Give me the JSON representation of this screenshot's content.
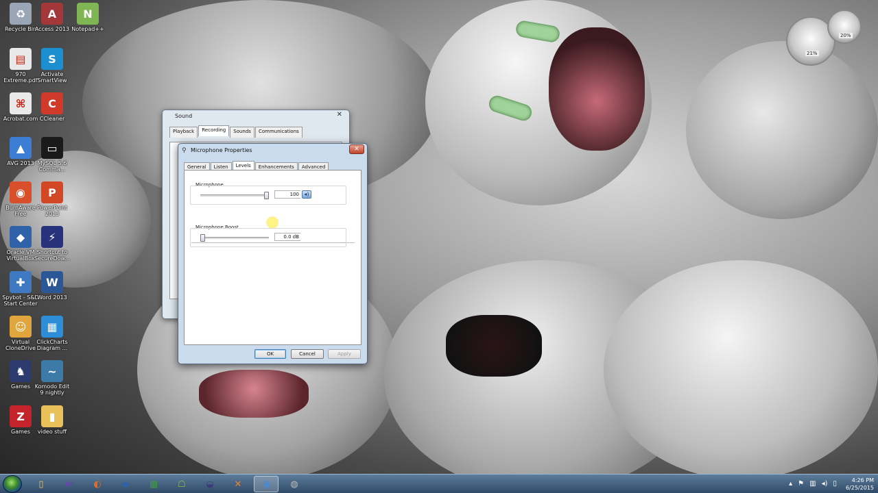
{
  "desktop": {
    "icons": [
      {
        "label": "Recycle Bin",
        "icon": "recycle-bin-icon",
        "color": "#9aa6b5",
        "glyph": "♻"
      },
      {
        "label": "Access 2013",
        "icon": "access-icon",
        "color": "#a4373a",
        "glyph": "A"
      },
      {
        "label": "Notepad++",
        "icon": "notepad-plus-plus-icon",
        "color": "#7fb653",
        "glyph": "N"
      },
      {
        "label": "970 Extreme.pdf",
        "icon": "pdf-file-icon",
        "color": "#e9e9e9",
        "glyph": "▤"
      },
      {
        "label": "Activate SmartView",
        "icon": "smartview-icon",
        "color": "#1b8fcf",
        "glyph": "S"
      },
      {
        "label": "Acrobat.com",
        "icon": "acrobat-icon",
        "color": "#e9e9e9",
        "glyph": "⌘"
      },
      {
        "label": "CCleaner",
        "icon": "ccleaner-icon",
        "color": "#d03a2a",
        "glyph": "C"
      },
      {
        "label": "AVG 2013",
        "icon": "avg-icon",
        "color": "#3b7ed3",
        "glyph": "▲"
      },
      {
        "label": "MySQL 5.6 Comma...",
        "icon": "mysql-icon",
        "color": "#1a1a1a",
        "glyph": "▭"
      },
      {
        "label": "BurnAware Free",
        "icon": "burnaware-icon",
        "color": "#d84f2a",
        "glyph": "◉"
      },
      {
        "label": "PowerPoint 2013",
        "icon": "powerpoint-icon",
        "color": "#d24726",
        "glyph": "P"
      },
      {
        "label": "Oracle VM VirtualBox",
        "icon": "virtualbox-icon",
        "color": "#2f62a8",
        "glyph": "◆"
      },
      {
        "label": "Shortcut to SecureDow...",
        "icon": "securedownload-icon",
        "color": "#26327a",
        "glyph": "⚡"
      },
      {
        "label": "Spybot - S&D Start Center",
        "icon": "spybot-icon",
        "color": "#3f79c2",
        "glyph": "✚"
      },
      {
        "label": "Word 2013",
        "icon": "word-icon",
        "color": "#2b5797",
        "glyph": "W"
      },
      {
        "label": "Virtual CloneDrive",
        "icon": "clonedrive-icon",
        "color": "#e0a53c",
        "glyph": "☺"
      },
      {
        "label": "ClickCharts Diagram ...",
        "icon": "clickcharts-icon",
        "color": "#2d8dd6",
        "glyph": "▦"
      },
      {
        "label": "Games",
        "icon": "games-icon",
        "color": "#2c3b6e",
        "glyph": "♞"
      },
      {
        "label": "Komodo Edit 9 nightly",
        "icon": "komodo-icon",
        "color": "#3e7aa8",
        "glyph": "~"
      },
      {
        "label": "Games",
        "icon": "zynga-games-icon",
        "color": "#c4232b",
        "glyph": "Z"
      },
      {
        "label": "video stuff",
        "icon": "folder-icon",
        "color": "#e8c15a",
        "glyph": "▮"
      }
    ]
  },
  "gadget": {
    "cpu": "21%",
    "memory": "20%"
  },
  "sound_window": {
    "title": "Sound",
    "tabs": [
      "Playback",
      "Recording",
      "Sounds",
      "Communications"
    ],
    "active_tab": "Recording"
  },
  "mic_window": {
    "title": "Microphone Properties",
    "tabs": [
      "General",
      "Listen",
      "Levels",
      "Enhancements",
      "Advanced"
    ],
    "active_tab": "Levels",
    "microphone": {
      "label": "Microphone",
      "value": "100",
      "level": 1.0
    },
    "boost": {
      "label": "Microphone Boost",
      "value": "0.0 dB",
      "level": 0.0
    },
    "buttons": {
      "ok": "OK",
      "cancel": "Cancel",
      "apply": "Apply"
    }
  },
  "taskbar": {
    "apps": [
      {
        "icon": "windows-explorer-icon",
        "glyph": "▯",
        "color": "#e6c260"
      },
      {
        "icon": "visual-studio-icon",
        "glyph": "⋈",
        "color": "#6b3fb1"
      },
      {
        "icon": "firefox-icon",
        "glyph": "◐",
        "color": "#e66a1f"
      },
      {
        "icon": "virtualbox-icon",
        "glyph": "◆",
        "color": "#2f62a8"
      },
      {
        "icon": "task-manager-icon",
        "glyph": "▦",
        "color": "#3f9a3f"
      },
      {
        "icon": "android-icon",
        "glyph": "☖",
        "color": "#8cc14a"
      },
      {
        "icon": "eclipse-icon",
        "glyph": "◒",
        "color": "#3c3a7a"
      },
      {
        "icon": "xampp-icon",
        "glyph": "✕",
        "color": "#f28026"
      },
      {
        "icon": "screen-recorder-icon",
        "glyph": "▣",
        "color": "#4a8ad0"
      },
      {
        "icon": "sound-control-panel-icon",
        "glyph": "◍",
        "color": "#bdbdbd"
      }
    ],
    "active_index": 8,
    "time": "4:26 PM",
    "date": "6/25/2015"
  }
}
